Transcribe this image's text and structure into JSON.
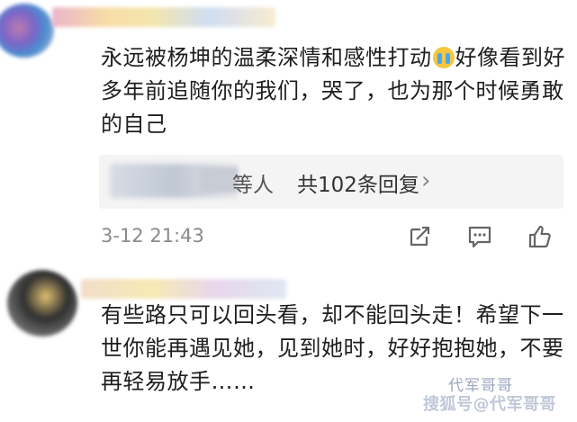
{
  "comments": [
    {
      "text_before_emoji": "永远被杨坤的温柔深情和感性打动",
      "emoji": "crying-face",
      "text_after_emoji": "好像看到好多年前追随你的我们，哭了，也为那个时候勇敢的自己",
      "replies": {
        "suffix": "等人",
        "count_label": "共102条回复",
        "chevron": "›"
      },
      "timestamp": "3-12 21:43",
      "actions": [
        "share-icon",
        "comment-icon",
        "like-icon"
      ]
    },
    {
      "text": "有些路只可以回头看，却不能回头走！希望下一世你能再遇见她，见到她时，好好抱抱她，不要再轻易放手……"
    }
  ],
  "watermark": {
    "top": "代军哥哥",
    "bottom": "搜狐号@代军哥哥"
  },
  "colors": {
    "text": "#1e1e1e",
    "meta": "#8a8a8a",
    "reply_box": "#f4f4f4"
  }
}
